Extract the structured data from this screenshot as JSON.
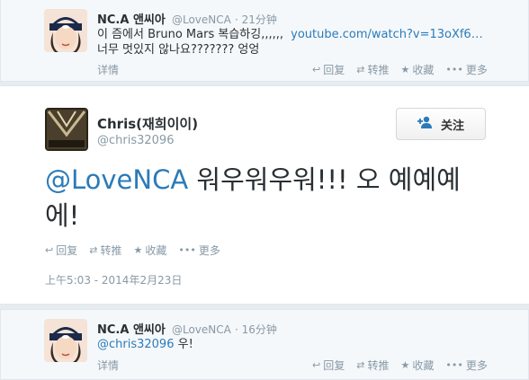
{
  "top_tweet": {
    "name": "NC.A 앤씨아",
    "handle": "@LoveNCA",
    "time": "21分钟",
    "text_line1": "이 즘에서 Bruno Mars 복습하깅,,,,,,",
    "link": "youtube.com/watch?v=13oXf6…",
    "text_line2": "너무 멋있지 않나요??????? 엉엉",
    "details": "详情",
    "actions": {
      "reply": "回复",
      "retweet": "转推",
      "favorite": "收藏",
      "more": "更多"
    }
  },
  "main_tweet": {
    "name": "Chris(재희이이)",
    "handle": "@chris32096",
    "follow_label": "关注",
    "mention": "@LoveNCA",
    "text": " 워우워우워!!! 오 예예예에!",
    "actions": {
      "reply": "回复",
      "retweet": "转推",
      "favorite": "收藏",
      "more": "更多"
    },
    "timestamp": "上午5:03 - 2014年2月23日"
  },
  "bottom_tweet": {
    "name": "NC.A 앤씨아",
    "handle": "@LoveNCA",
    "time": "16分钟",
    "mention": "@chris32096",
    "text": " 우!",
    "details": "详情",
    "actions": {
      "reply": "回复",
      "retweet": "转推",
      "favorite": "收藏",
      "more": "更多"
    }
  },
  "colors": {
    "link": "#2b7bb9",
    "muted": "#8899a6",
    "text": "#292f33"
  }
}
